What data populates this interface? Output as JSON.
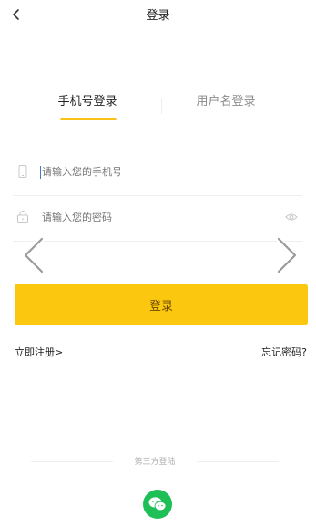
{
  "header": {
    "title": "登录"
  },
  "tabs": [
    {
      "label": "手机号登录",
      "active": true
    },
    {
      "label": "用户名登录",
      "active": false
    }
  ],
  "form": {
    "phone_placeholder": "请输入您的手机号",
    "password_placeholder": "请输入您的密码",
    "login_label": "登录"
  },
  "links": {
    "register": "立即注册>",
    "forgot_password": "忘记密码?"
  },
  "third_party": {
    "label": "第三方登陆"
  },
  "colors": {
    "accent": "#fbc70f",
    "tab_underline": "#f8c21a",
    "wechat": "#1fbf58"
  },
  "icons": [
    "back-arrow-icon",
    "phone-icon",
    "lock-icon",
    "eye-icon",
    "chevron-left-icon",
    "chevron-right-icon",
    "wechat-icon"
  ]
}
